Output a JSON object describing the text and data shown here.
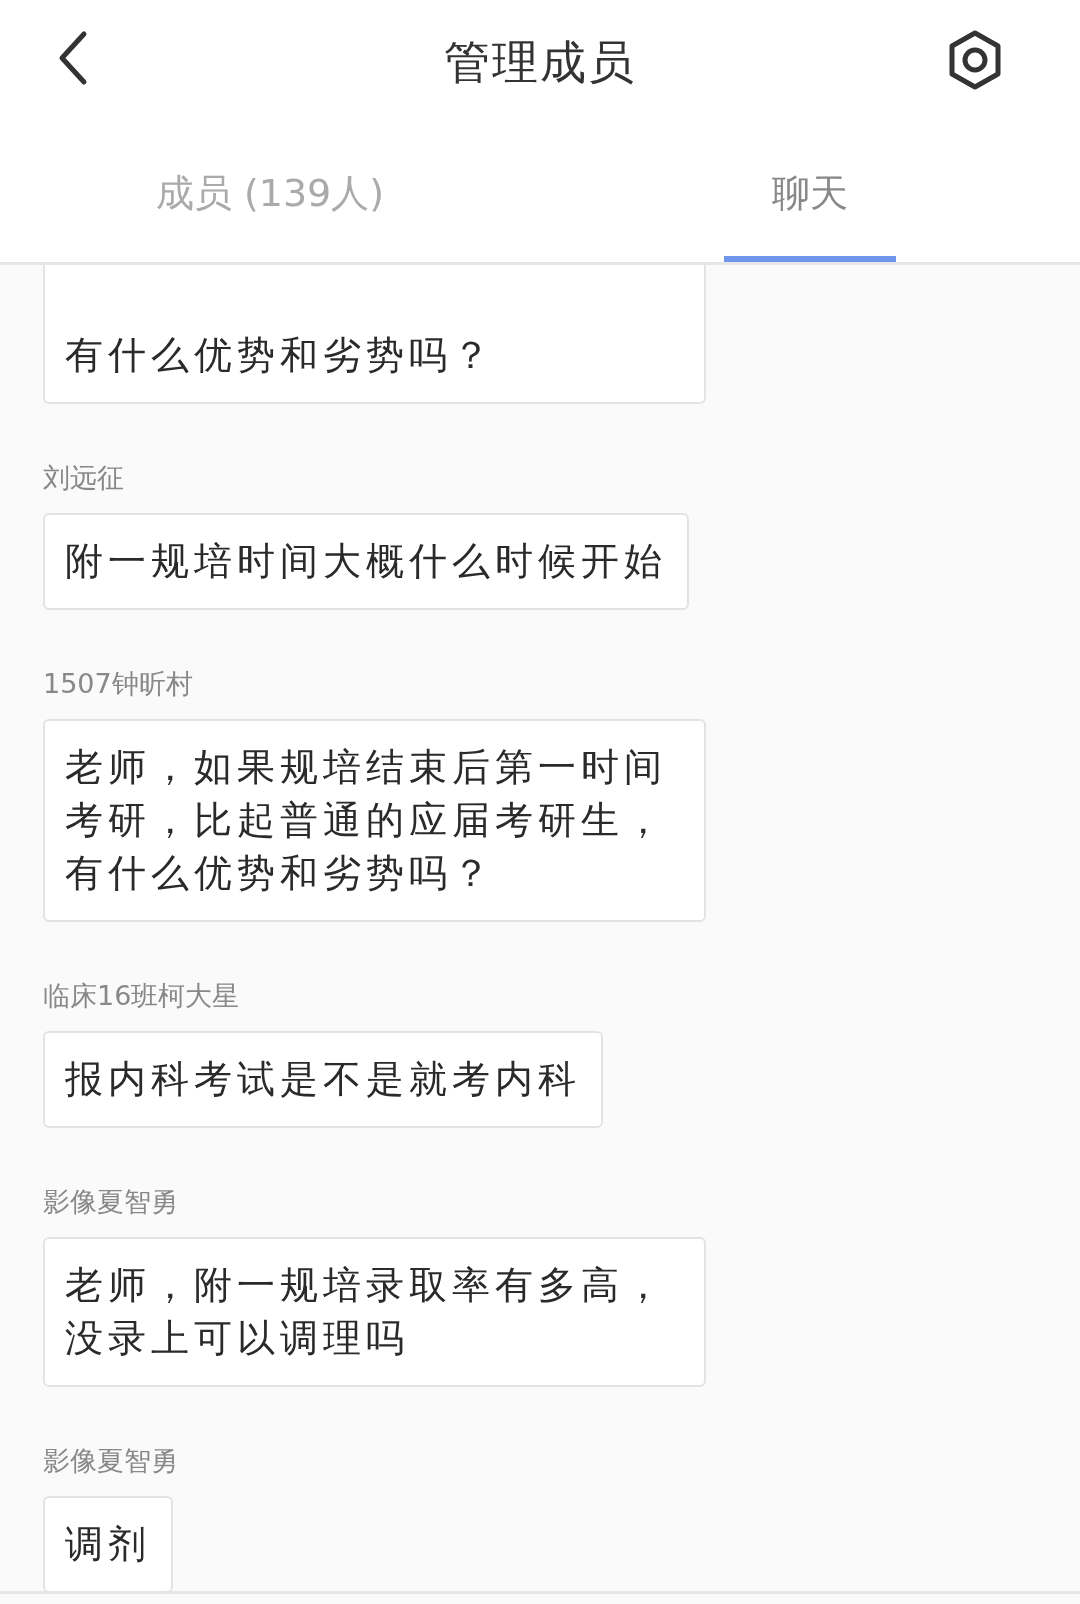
{
  "header": {
    "title": "管理成员"
  },
  "tabs": [
    {
      "label": "成员 (139人)",
      "selected": false
    },
    {
      "label": "聊天",
      "selected": true
    }
  ],
  "messages": [
    {
      "text": "有什么优势和劣势吗？"
    },
    {
      "sender": "刘远征",
      "text": "附一规培时间大概什么时候开始"
    },
    {
      "sender": "1507钟昕村",
      "text": "老师，如果规培结束后第一时间考研，比起普通的应届考研生，有什么优势和劣势吗？"
    },
    {
      "sender": "临床16班柯大星",
      "text": "报内科考试是不是就考内科"
    },
    {
      "sender": "影像夏智勇",
      "text": "老师，附一规培录取率有多高，没录上可以调理吗"
    },
    {
      "sender": "影像夏智勇",
      "text": "调剂"
    }
  ]
}
